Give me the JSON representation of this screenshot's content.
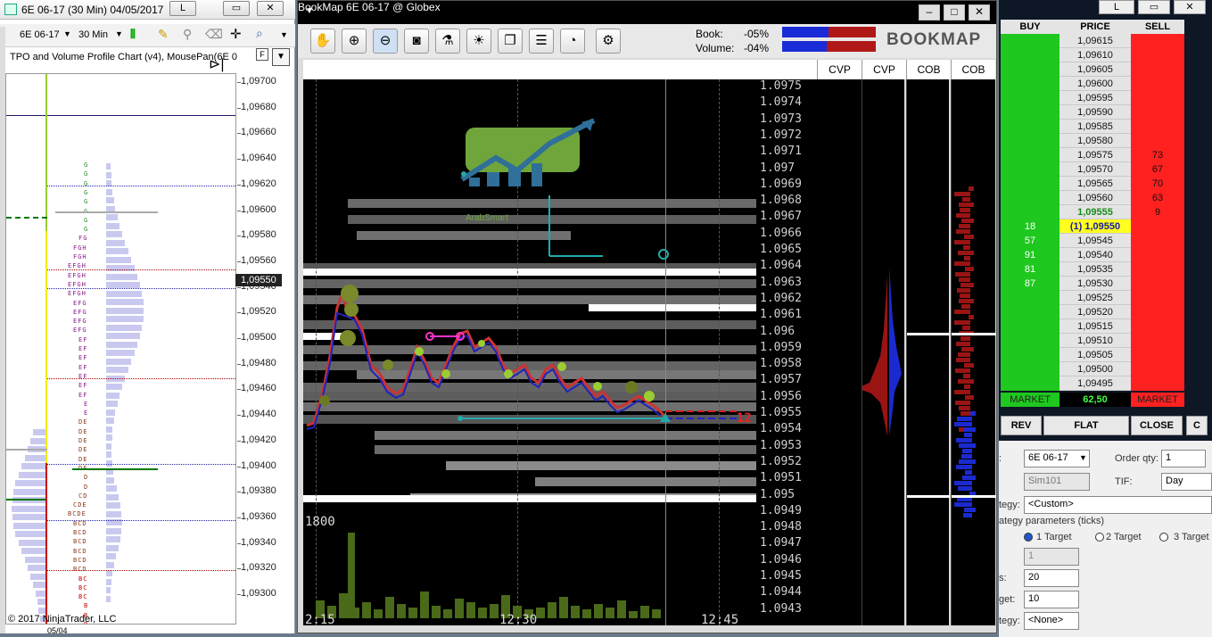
{
  "tpo": {
    "window_title": "6E 06-17 (30 Min)  04/05/2017",
    "title_btns": [
      "L",
      "▭",
      "✕"
    ],
    "instrument": "6E 06-17",
    "interval": "30 Min",
    "indicator_label": "TPO and Volume Profile Chart (v4), MousePan(6E 0",
    "copyright": "© 2017 NinjaTrader, LLC",
    "date_label": "05/04",
    "last_price": "1,09550",
    "y_ticks": [
      "1,09700",
      "1,09680",
      "1,09660",
      "1,09640",
      "1,09620",
      "1,09600",
      "1,09580",
      "1,09560",
      "1,09540",
      "1,09520",
      "1,09500",
      "1,09480",
      "1,09460",
      "1,09440",
      "1,09420",
      "1,09400",
      "1,09380",
      "1,09360",
      "1,09340",
      "1,09320",
      "1,09300"
    ],
    "tpo_rows": [
      "G",
      "G",
      "G",
      "G",
      "G",
      "G",
      "G",
      "G",
      "FG",
      "FGH",
      "FGH",
      "EFGH",
      "EFGH",
      "EFGH",
      "EFGH",
      "EFG",
      "EFG",
      "EFG",
      "EFG",
      "EF",
      "EF",
      "EF",
      "EF",
      "EF",
      "EF",
      "EF",
      "E",
      "E",
      "DE",
      "DE",
      "DE",
      "DE",
      "DE",
      "DE",
      "D",
      "D",
      "CD",
      "CDE",
      "BCDE",
      "BCD",
      "BCD",
      "BCD",
      "BCD",
      "BCD",
      "BCD",
      "BC",
      "BC",
      "BC",
      "B",
      "B",
      "B",
      "B",
      "B"
    ]
  },
  "bookmap": {
    "window_title": "BookMap    6E 06-17 @ Globex",
    "brand": "BOOKMAP",
    "book_label": "Book:",
    "book_value": "-05%",
    "volume_label": "Volume:",
    "volume_value": "-04%",
    "columns": [
      "CVP",
      "CVP",
      "COB",
      "COB"
    ],
    "price_ticks": [
      "1.0975",
      "1.0974",
      "1.0973",
      "1.0972",
      "1.0971",
      "1.097",
      "1.0969",
      "1.0968",
      "1.0967",
      "1.0966",
      "1.0965",
      "1.0964",
      "1.0963",
      "1.0962",
      "1.0961",
      "1.096",
      "1.0959",
      "1.0958",
      "1.0957",
      "1.0956",
      "1.0955",
      "1.0954",
      "1.0953",
      "1.0952",
      "1.0951",
      "1.095",
      "1.0949",
      "1.0948",
      "1.0947",
      "1.0946",
      "1.0945",
      "1.0944",
      "1.0943"
    ],
    "time_labels": [
      "2:15",
      "12:30",
      "12:45"
    ],
    "volume_scale": "1800",
    "order_marker": "12",
    "toolbar_icons": [
      "hand-icon",
      "zoom-in-icon",
      "zoom-out-icon",
      "camera-icon",
      "microscope-icon",
      "brightness-icon",
      "copy-icon",
      "chat-icon",
      "clock-icon",
      "gear-icon"
    ],
    "watermark_text": "ArabSmart"
  },
  "dom": {
    "headers": {
      "buy": "BUY",
      "price": "PRICE",
      "sell": "SELL"
    },
    "rows": [
      {
        "buy": "",
        "price": "1,09615",
        "sell": ""
      },
      {
        "buy": "",
        "price": "1,09610",
        "sell": ""
      },
      {
        "buy": "",
        "price": "1,09605",
        "sell": ""
      },
      {
        "buy": "",
        "price": "1,09600",
        "sell": ""
      },
      {
        "buy": "",
        "price": "1,09595",
        "sell": ""
      },
      {
        "buy": "",
        "price": "1,09590",
        "sell": ""
      },
      {
        "buy": "",
        "price": "1,09585",
        "sell": ""
      },
      {
        "buy": "",
        "price": "1,09580",
        "sell": ""
      },
      {
        "buy": "",
        "price": "1,09575",
        "sell": "73"
      },
      {
        "buy": "",
        "price": "1,09570",
        "sell": "67"
      },
      {
        "buy": "",
        "price": "1,09565",
        "sell": "70"
      },
      {
        "buy": "",
        "price": "1,09560",
        "sell": "63"
      },
      {
        "buy": "",
        "price": "1,09555",
        "sell": "9"
      },
      {
        "buy": "18",
        "price": "(1) 1,09550",
        "sell": ""
      },
      {
        "buy": "57",
        "price": "1,09545",
        "sell": ""
      },
      {
        "buy": "91",
        "price": "1,09540",
        "sell": ""
      },
      {
        "buy": "81",
        "price": "1,09535",
        "sell": ""
      },
      {
        "buy": "87",
        "price": "1,09530",
        "sell": ""
      },
      {
        "buy": "",
        "price": "1,09525",
        "sell": ""
      },
      {
        "buy": "",
        "price": "1,09520",
        "sell": ""
      },
      {
        "buy": "",
        "price": "1,09515",
        "sell": ""
      },
      {
        "buy": "",
        "price": "1,09510",
        "sell": ""
      },
      {
        "buy": "",
        "price": "1,09505",
        "sell": ""
      },
      {
        "buy": "",
        "price": "1,09500",
        "sell": ""
      },
      {
        "buy": "",
        "price": "1,09495",
        "sell": ""
      }
    ],
    "market_buy": "MARKET",
    "market_value": "62,50",
    "market_sell": "MARKET",
    "buttons": {
      "rev": "REV",
      "flat": "FLAT",
      "close": "CLOSE",
      "c": "C"
    },
    "instrument": "6E 06-17",
    "order_qty_label": "Order qty:",
    "order_qty": "1",
    "account": "Sim101",
    "tif_label": "TIF:",
    "tif": "Day",
    "strategy_label": "tegy:",
    "strategy": "<Custom>",
    "params_label": "ategy parameters (ticks)",
    "targets": [
      "1 Target",
      "2 Target",
      "3 Target"
    ],
    "target_value": "1",
    "stop_label": "s:",
    "stop_value": "20",
    "profit_label": "get:",
    "profit_value": "10",
    "strategy2_label": "tegy:",
    "strategy2": "<None>"
  }
}
